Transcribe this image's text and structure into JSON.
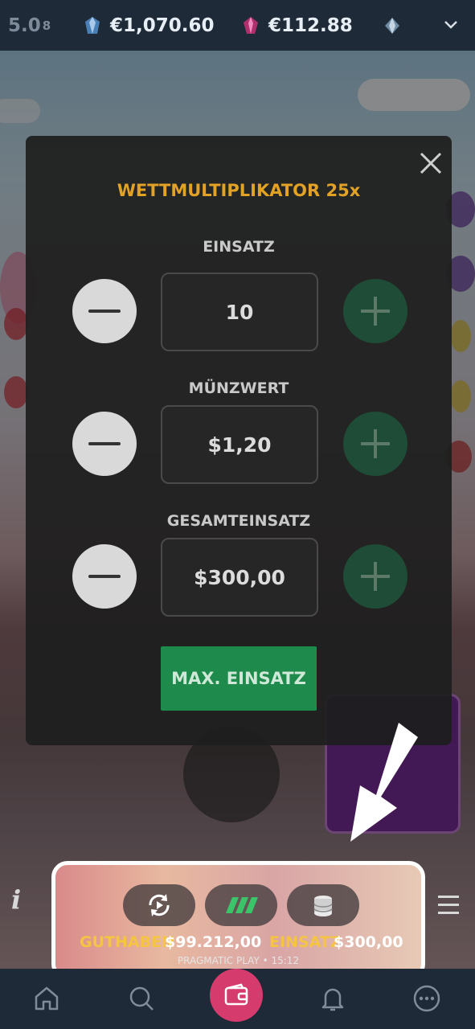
{
  "wallet_bar": {
    "partial_value": "5.0",
    "partial_superscript": "8",
    "balances": [
      {
        "icon": "blue-gem-icon",
        "amount": "€1,070.60"
      },
      {
        "icon": "pink-gem-icon",
        "amount": "€112.88"
      },
      {
        "icon": "diamond-gem-icon",
        "amount": ""
      }
    ],
    "dropdown_icon": "chevron-down-icon"
  },
  "bet_modal": {
    "multiplier_label": "WETTMULTIPLIKATOR 25x",
    "rows": [
      {
        "label": "EINSATZ",
        "value": "10"
      },
      {
        "label": "MÜNZWERT",
        "value": "$1,20"
      },
      {
        "label": "GESAMTEINSATZ",
        "value": "$300,00"
      }
    ],
    "max_bet_label": "MAX. EINSATZ",
    "close_icon": "close-icon"
  },
  "game_bar": {
    "balance_label": "GUTHABEN",
    "balance_value": "$99.212,00",
    "bet_label": "EINSATZ",
    "bet_value": "$300,00",
    "footer": "PRAGMATIC PLAY • 15:12",
    "info_icon_text": "i"
  },
  "colors": {
    "accent_gold": "#e2a225",
    "max_button": "#1e8a4c",
    "nav_highlight": "#d63b6e",
    "bar_background": "#1e2a38"
  },
  "bottom_nav": {
    "items": [
      "home-icon",
      "search-icon",
      "wallet-icon",
      "bell-icon",
      "more-icon"
    ]
  }
}
